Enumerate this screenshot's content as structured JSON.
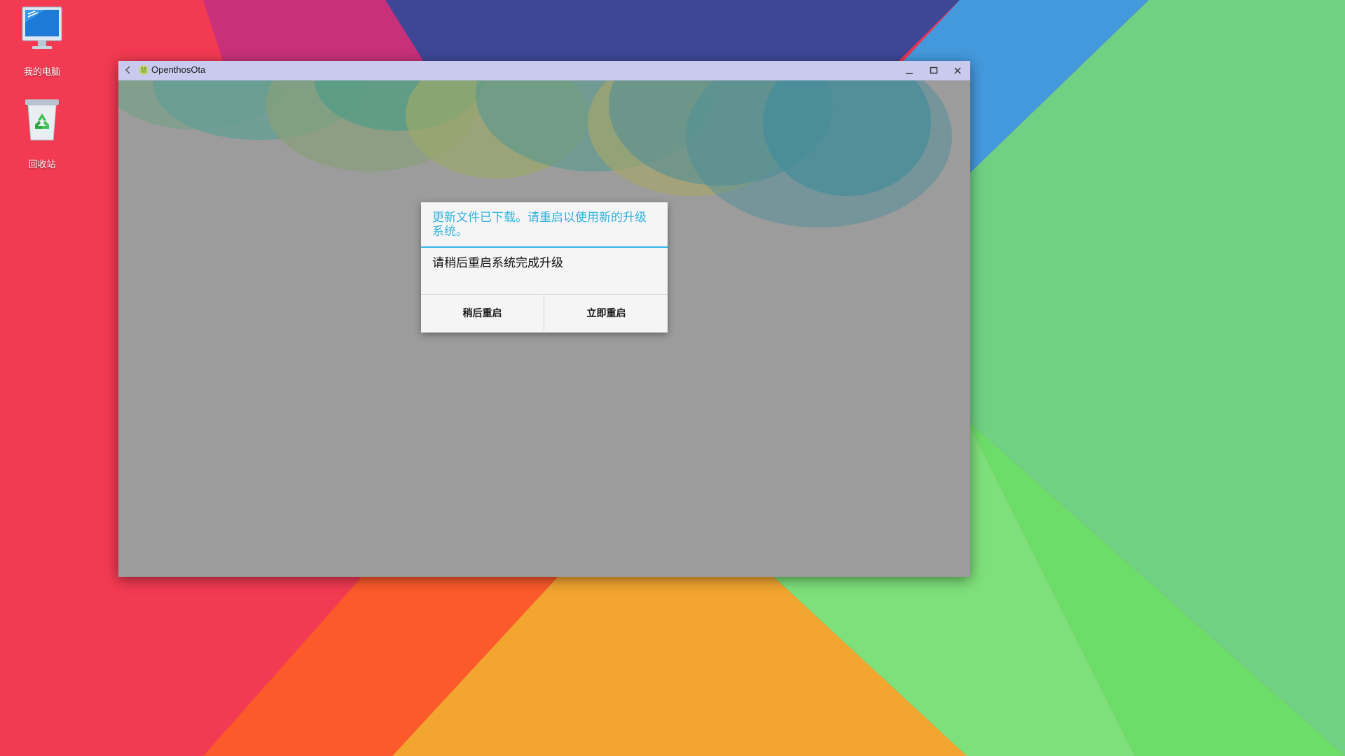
{
  "desktop": {
    "icons": [
      {
        "label": "我的电脑",
        "icon": "computer-monitor-icon"
      },
      {
        "label": "回收站",
        "icon": "recycle-bin-icon"
      }
    ],
    "wallpaper_colors": [
      "#f0334f",
      "#c8307a",
      "#3a4a9a",
      "#4aa6e0",
      "#6ed68c",
      "#ff5a2a",
      "#f4a62a",
      "#6ee06a"
    ]
  },
  "window": {
    "title": "OpenthosOta",
    "back_icon": "chevron-left-icon",
    "app_icon": "android-ota-icon",
    "controls": [
      "minimize-icon",
      "maximize-icon",
      "close-icon"
    ],
    "titlebar_color": "#c8cbee",
    "content_color": "#9c9c9c"
  },
  "dialog": {
    "title": "更新文件已下载。请重启以使用新的升级系统。",
    "message": "请稍后重启系统完成升级",
    "later_button": "稍后重启",
    "now_button": "立即重启",
    "accent_color": "#33b5e5"
  }
}
